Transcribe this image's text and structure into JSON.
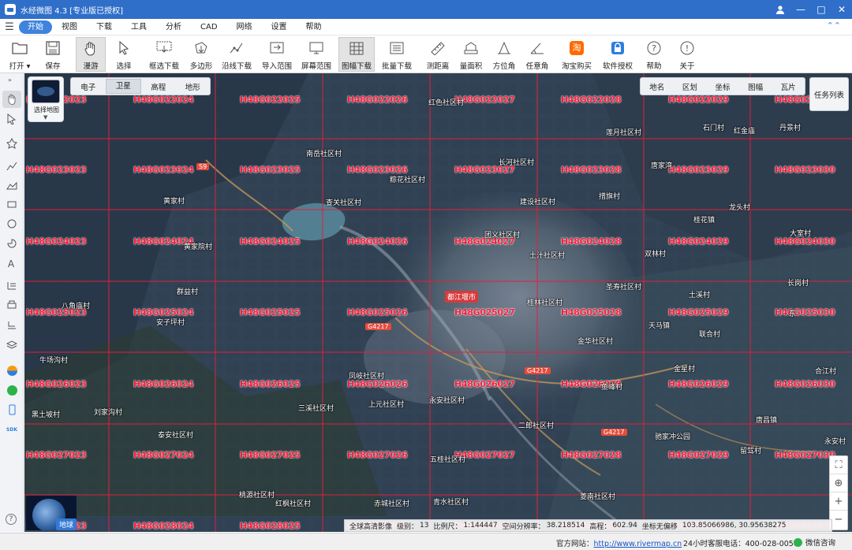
{
  "window": {
    "title": "水经微图 4.3 [专业版已授权]",
    "controls": [
      "user-icon",
      "minimize-icon",
      "maximize-icon",
      "close-icon"
    ]
  },
  "menu": {
    "items": [
      "开始",
      "视图",
      "下载",
      "工具",
      "分析",
      "CAD",
      "网络",
      "设置",
      "帮助"
    ],
    "active": "开始"
  },
  "toolbar": {
    "items": [
      {
        "label": "打开",
        "icon": "folder-icon",
        "dropdown": true
      },
      {
        "label": "保存",
        "icon": "save-icon"
      },
      {
        "label": "漫游",
        "icon": "hand-icon",
        "selected": true
      },
      {
        "label": "选择",
        "icon": "cursor-icon"
      },
      {
        "label": "框选下载",
        "icon": "box-download-icon"
      },
      {
        "label": "多边形",
        "icon": "polygon-download-icon"
      },
      {
        "label": "沿线下载",
        "icon": "line-download-icon"
      },
      {
        "label": "导入范围",
        "icon": "import-range-icon"
      },
      {
        "label": "屏幕范围",
        "icon": "screen-range-icon"
      },
      {
        "label": "图幅下载",
        "icon": "sheet-download-icon",
        "selected": true
      },
      {
        "label": "批量下载",
        "icon": "batch-download-icon"
      },
      {
        "label": "测距离",
        "icon": "ruler-icon"
      },
      {
        "label": "量面积",
        "icon": "area-icon"
      },
      {
        "label": "方位角",
        "icon": "azimuth-icon"
      },
      {
        "label": "任意角",
        "icon": "angle-icon"
      },
      {
        "label": "淘宝购买",
        "icon": "taobao-icon"
      },
      {
        "label": "软件授权",
        "icon": "license-icon"
      },
      {
        "label": "帮助",
        "icon": "help-icon"
      },
      {
        "label": "关于",
        "icon": "info-icon"
      }
    ]
  },
  "map": {
    "layer_switch_label": "选择地图",
    "map_types": [
      "电子",
      "卫星",
      "高程",
      "地形"
    ],
    "active_map_type": "卫星",
    "overlays": [
      "地名",
      "区划",
      "坐标",
      "图幅",
      "瓦片"
    ],
    "task_list": "任务列表",
    "globe_label": "地球",
    "sheet_labels": [
      [
        "H48G022023",
        "H48G022024",
        "H48G022025",
        "H48G022026",
        "H48G022027",
        "H48G022028",
        "H48G022029",
        "H48G022030"
      ],
      [
        "H48G023023",
        "H48G023024",
        "H48G023025",
        "H48G023026",
        "H48G023027",
        "H48G023028",
        "H48G023029",
        "H48G023030"
      ],
      [
        "H48G024023",
        "H48G024024",
        "H48G024025",
        "H48G024026",
        "H48G024027",
        "H48G024028",
        "H48G024029",
        "H48G024030"
      ],
      [
        "H48G025023",
        "H48G025024",
        "H48G025025",
        "H48G025026",
        "H48G025027",
        "H48G025028",
        "H48G025029",
        "H48G025030"
      ],
      [
        "H48G026023",
        "H48G026024",
        "H48G026025",
        "H48G026026",
        "H48G026027",
        "H48G026028",
        "H48G026029",
        "H48G026030"
      ],
      [
        "H48G027023",
        "H48G027024",
        "H48G027025",
        "H48G027026",
        "H48G027027",
        "H48G027028",
        "H48G027029",
        "H48G027030"
      ],
      [
        "H48G028023",
        "H48G028024",
        "H48G028025",
        "H48G028026",
        "H48G028027",
        "H48G028028",
        "H48G028029",
        "H48G028030"
      ]
    ],
    "places": [
      "红色社区村",
      "莲月社区村",
      "石门村",
      "红金庙",
      "丹景村",
      "南岳社区村",
      "长河社区村",
      "唐家湾",
      "粽花社区村",
      "措旗村",
      "黄家村",
      "查关社区村",
      "建设社区村",
      "龙头村",
      "桂花镇",
      "黄家院村",
      "团义社区村",
      "大室村",
      "土汁社区村",
      "双林村",
      "群益村",
      "圣寿社区村",
      "长岗村",
      "八角庙村",
      "桂林社区村",
      "土溪村",
      "安子坪村",
      "天马镇",
      "东",
      "联合村",
      "金华社区村",
      "牛场沟村",
      "金星村",
      "合江村",
      "凤岐社区村",
      "上元社区村",
      "永安社区村",
      "鱼峰村",
      "黑土坡村",
      "刘家沟村",
      "三溪社区村",
      "二郎社区村",
      "唐昌镇",
      "泰安社区村",
      "驰家冲公园",
      "留驾村",
      "永安村",
      "五桂社区村",
      "桃源社区村",
      "红枫社区村",
      "赤城社区村",
      "青水社区村",
      "菱南社区村"
    ],
    "city_label": "都江堰市",
    "roads": [
      "S9",
      "G4217",
      "G4217",
      "G4217"
    ],
    "info_bar": {
      "source": "全球高清影像",
      "level_label": "级别：",
      "level": "13",
      "scale_label": "比例尺：",
      "scale": "1:144447",
      "resolution_label": "空间分辨率：",
      "resolution": "38.218514",
      "elevation_label": "高程：",
      "elevation": "602.94",
      "coord_label": "坐标无偏移",
      "coords": "103.85066986, 30.95638275"
    }
  },
  "status": {
    "site_label": "官方网站：",
    "site_url": "http://www.rivermap.cn",
    "phone": "24小时客服电话：400-028-0050",
    "wechat": "微信咨询"
  },
  "colors": {
    "titlebar": "#2f6fc9",
    "menu_active": "#3f83dd",
    "grid_line": "#e0203a",
    "sheet_label": "#ff1d3a"
  }
}
